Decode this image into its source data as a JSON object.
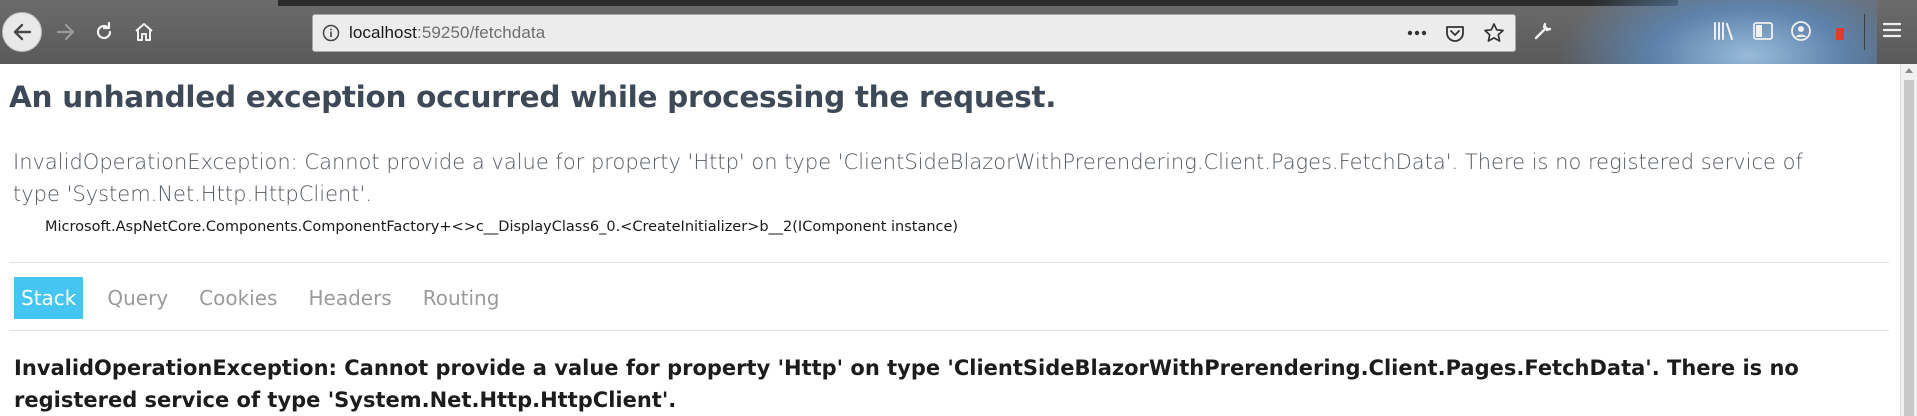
{
  "browser": {
    "url_host": "localhost",
    "url_path": ":59250/fetchdata",
    "icons": [
      "back-icon",
      "forward-icon",
      "reload-icon",
      "home-icon",
      "info-icon",
      "more-icon",
      "pocket-icon",
      "bookmark-star-icon",
      "wrench-icon",
      "library-icon",
      "sidebar-icon",
      "account-icon",
      "menu-icon"
    ]
  },
  "error_page": {
    "title": "An unhandled exception occurred while processing the request.",
    "summary": "InvalidOperationException: Cannot provide a value for property 'Http' on type 'ClientSideBlazorWithPrerendering.Client.Pages.FetchData'. There is no registered service of type 'System.Net.Http.HttpClient'.",
    "location": "Microsoft.AspNetCore.Components.ComponentFactory+<>c__DisplayClass6_0.<CreateInitializer>b__2(IComponent instance)",
    "tabs": [
      {
        "label": "Stack",
        "selected": true
      },
      {
        "label": "Query",
        "selected": false
      },
      {
        "label": "Cookies",
        "selected": false
      },
      {
        "label": "Headers",
        "selected": false
      },
      {
        "label": "Routing",
        "selected": false
      }
    ],
    "stack_title": "InvalidOperationException: Cannot provide a value for property 'Http' on type 'ClientSideBlazorWithPrerendering.Client.Pages.FetchData'. There is no registered service of type 'System.Net.Http.HttpClient'."
  },
  "colors": {
    "selected_tab": "#44c5f2",
    "title_text": "#3d4956",
    "toolbar": "#5f5f5f"
  }
}
